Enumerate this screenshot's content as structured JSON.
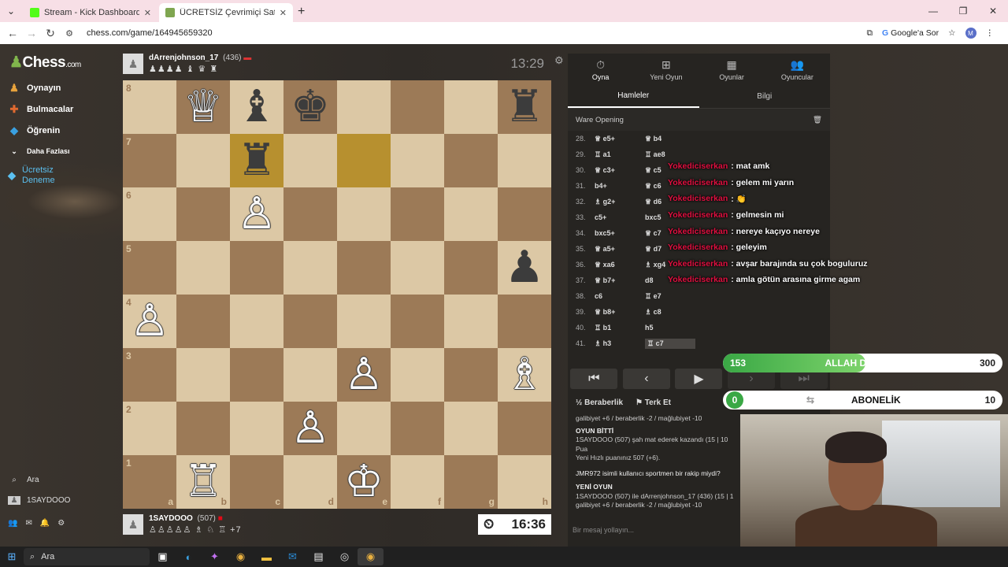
{
  "browser": {
    "tabs": [
      {
        "title": "Stream - Kick Dashboard",
        "favicon_color": "#53fc18"
      },
      {
        "title": "ÜCRETSİZ Çevrimiçi Satranç Oy",
        "favicon_color": "#7fa650"
      }
    ],
    "url": "chess.com/game/164945659320",
    "google_label": "Google'a Sor",
    "profile_initial": "M"
  },
  "sidebar": {
    "logo": "Chess",
    "logo_suffix": ".com",
    "items": [
      {
        "label": "Oynayın",
        "icon": "pawn-icon"
      },
      {
        "label": "Bulmacalar",
        "icon": "puzzle-icon"
      },
      {
        "label": "Öğrenin",
        "icon": "learn-icon"
      },
      {
        "label": "Daha Fazlası",
        "icon": "chevron-down-icon"
      },
      {
        "label": "Ücretsiz Deneme",
        "icon": "diamond-icon"
      }
    ],
    "search_label": "Ara",
    "user_label": "1SAYDOOO"
  },
  "top_player": {
    "name": "dArrenjohnson_17",
    "rating": "(436)",
    "captured": "♟♟♟♟ ♝ ♛ ♜"
  },
  "bottom_player": {
    "name": "1SAYDOOO",
    "rating": "(507)",
    "captured": "♙♙♙♙♙ ♗ ♘ ♖",
    "advantage": "+7"
  },
  "clocks": {
    "top": "13:29",
    "bottom": "16:36"
  },
  "board": {
    "ranks": [
      "8",
      "7",
      "6",
      "5",
      "4",
      "3",
      "2",
      "1"
    ],
    "files": [
      "a",
      "b",
      "c",
      "d",
      "e",
      "f",
      "g",
      "h"
    ],
    "pieces": {
      "b8": "wQ",
      "c8": "bB",
      "d8": "bK",
      "h8": "bR",
      "c7": "bR",
      "c6": "wP",
      "h5": "bP",
      "a4": "wP",
      "e3": "wP",
      "h3": "wB",
      "d2": "wP",
      "b1": "wR",
      "e1": "wK"
    },
    "highlights": [
      "c7",
      "e7"
    ]
  },
  "panel": {
    "tabs": [
      {
        "label": "Oyna",
        "icon": "clock-icon"
      },
      {
        "label": "Yeni Oyun",
        "icon": "plus-icon"
      },
      {
        "label": "Oyunlar",
        "icon": "grid-icon"
      },
      {
        "label": "Oyuncular",
        "icon": "users-icon"
      }
    ],
    "subtabs": [
      "Hamleler",
      "Bilgi"
    ],
    "opening": "Ware Opening",
    "moves": [
      {
        "no": "28.",
        "w": "♕ e5+",
        "b": "♕ b4"
      },
      {
        "no": "29.",
        "w": "♖ a1",
        "b": "♖ ae8"
      },
      {
        "no": "30.",
        "w": "♕ c3+",
        "b": "♕ c5"
      },
      {
        "no": "31.",
        "w": "b4+",
        "b": "♕ c6"
      },
      {
        "no": "32.",
        "w": "♗ g2+",
        "b": "♕ d6"
      },
      {
        "no": "33.",
        "w": "c5+",
        "b": "bxc5"
      },
      {
        "no": "34.",
        "w": "bxc5+",
        "b": "♕ c7"
      },
      {
        "no": "35.",
        "w": "♕ a5+",
        "b": "♕ d7"
      },
      {
        "no": "36.",
        "w": "♕ xa6",
        "b": "♗ xg4"
      },
      {
        "no": "37.",
        "w": "♕ b7+",
        "b": "d8"
      },
      {
        "no": "38.",
        "w": "c6",
        "b": "♖ e7"
      },
      {
        "no": "39.",
        "w": "♕ b8+",
        "b": "♗ c8"
      },
      {
        "no": "40.",
        "w": "♖ b1",
        "b": "h5"
      },
      {
        "no": "41.",
        "w": "♗ h3",
        "b": "♖ c7"
      }
    ],
    "draw_label": "Beraberlik",
    "resign_label": "Terk Et",
    "log": {
      "stats1": "galibiyet +6 / beraberlik -2 / mağlubiyet -10",
      "h1": "OYUN BİTTİ",
      "l1": "1SAYDOOO (507) şah mat ederek kazandı (15 | 10 Pua",
      "l2": "Yeni Hızlı puanınız 507 (+6).",
      "l3": "JMR972 isimli kullanıcı sportmen bir rakip miydi?",
      "h2": "YENİ OYUN",
      "l4": "1SAYDOOO (507) ile dArrenjohnson_17 (436) (15 | 1",
      "stats2": "galibiyet +6 / beraberlik -2 / mağlubiyet -10"
    },
    "message_placeholder": "Bir mesaj yollayın..."
  },
  "chat_overlay": [
    {
      "user": "Yokediciserkan",
      "text": ": mat amk"
    },
    {
      "user": "Yokediciserkan",
      "text": ": gelem mi yarın"
    },
    {
      "user": "Yokediciserkan",
      "text": ": 👏"
    },
    {
      "user": "Yokediciserkan",
      "text": ": gelmesin mi"
    },
    {
      "user": "Yokediciserkan",
      "text": ": nereye kaçıyo nereye"
    },
    {
      "user": "Yokediciserkan",
      "text": ": geleyim"
    },
    {
      "user": "Yokediciserkan",
      "text": ": avşar barajında su çok boguluruz"
    },
    {
      "user": "Yokediciserkan",
      "text": ": amla götün arasına girme agam"
    }
  ],
  "goals": [
    {
      "label": "ALLAH DOSTLAR",
      "current": "153",
      "target": "300",
      "progress": 0.51
    },
    {
      "label": "ABONELİK",
      "current": "0",
      "target": "10",
      "progress": 0.0
    }
  ],
  "taskbar": {
    "search": "Ara"
  }
}
